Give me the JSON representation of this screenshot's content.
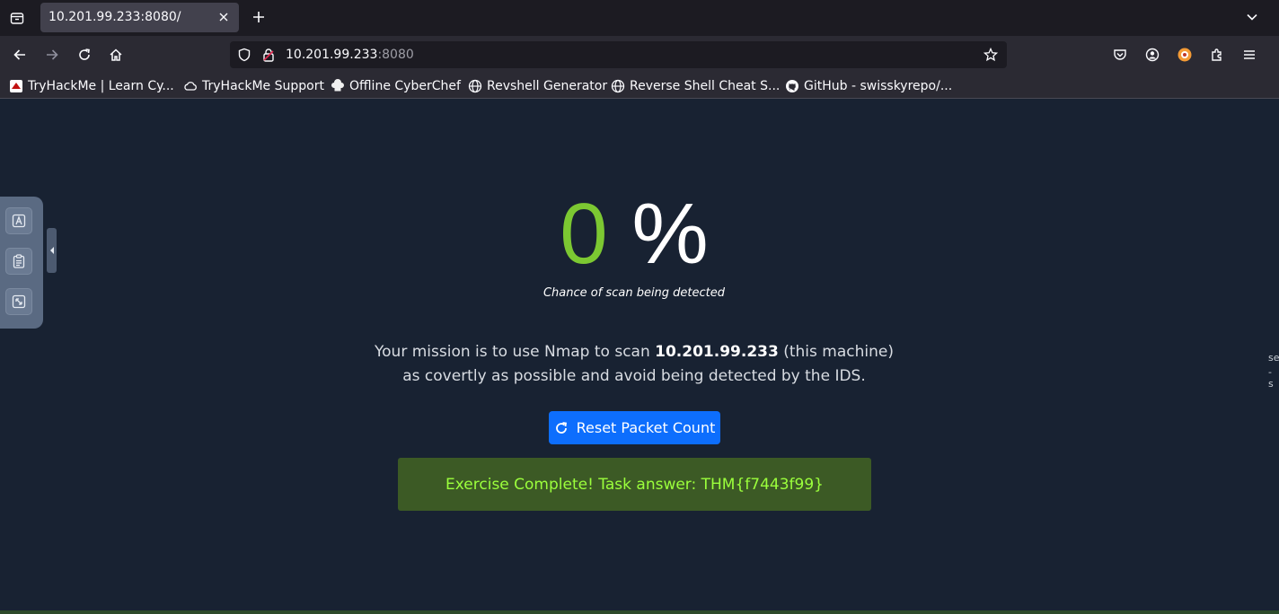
{
  "browser": {
    "tab_title": "10.201.99.233:8080/",
    "url_host": "10.201.99.233",
    "url_port": ":8080",
    "icons": [
      "tab-list-icon",
      "close-icon",
      "plus-icon",
      "chevron-down-icon",
      "back-arrow-icon",
      "forward-arrow-icon",
      "reload-icon",
      "home-icon",
      "shield-icon",
      "lock-icon",
      "star-icon",
      "pocket-icon",
      "account-icon",
      "extension-icon",
      "puzzle-icon",
      "menu-icon"
    ]
  },
  "bookmarks": [
    {
      "label": "TryHackMe | Learn Cy..."
    },
    {
      "label": "TryHackMe Support"
    },
    {
      "label": "Offline CyberChef"
    },
    {
      "label": "Revshell Generator"
    },
    {
      "label": "Reverse Shell Cheat S..."
    },
    {
      "label": "GitHub - swisskyrepo/..."
    }
  ],
  "page": {
    "percent_value": "0",
    "percent_sign": "%",
    "caption": "Chance of scan being detected",
    "mission_prefix": "Your mission is to use Nmap to scan ",
    "mission_ip": "10.201.99.233",
    "mission_suffix": " (this machine)",
    "mission_line2": "as covertly as possible and avoid being detected by the IDS.",
    "reset_label": "Reset Packet Count",
    "complete_message": "Exercise Complete! Task answer: THM{f7443f99}"
  },
  "side_panel": {
    "tools": [
      "text-icon",
      "clipboard-icon",
      "fullscreen-icon"
    ]
  },
  "edge_text": [
    "se",
    "- s"
  ],
  "colors": {
    "page_bg": "#182232",
    "accent_green": "#7cc832",
    "button_blue": "#0d6efd",
    "success_bg": "#3c5a25",
    "success_text": "#9bff3c"
  }
}
